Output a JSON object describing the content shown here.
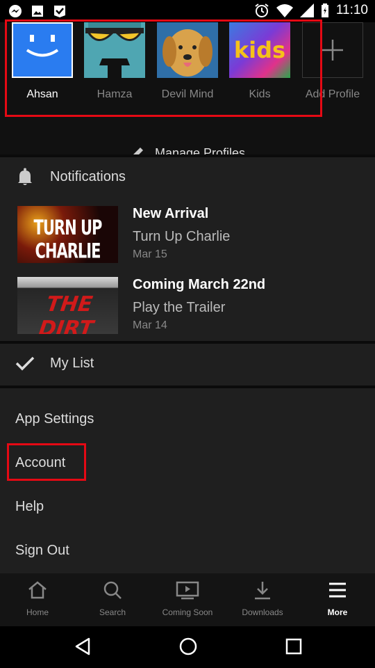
{
  "status_bar": {
    "time": "11:10"
  },
  "profiles": [
    {
      "name": "Ahsan",
      "active": true
    },
    {
      "name": "Hamza",
      "active": false
    },
    {
      "name": "Devil Mind",
      "active": false
    },
    {
      "name": "Kids",
      "active": false
    }
  ],
  "add_profile_label": "Add Profile",
  "kids_logo_text": "kids",
  "manage_profiles_label": "Manage Profiles",
  "notifications": {
    "heading": "Notifications",
    "items": [
      {
        "title": "New Arrival",
        "subtitle": "Turn Up Charlie",
        "date": "Mar 15",
        "thumb_text": "TURN UP CHARLIE"
      },
      {
        "title": "Coming March 22nd",
        "subtitle": "Play the Trailer",
        "date": "Mar 14",
        "thumb_text": "THE DIRT"
      }
    ]
  },
  "my_list_label": "My List",
  "menu": [
    "App Settings",
    "Account",
    "Help",
    "Sign Out"
  ],
  "tabs": [
    {
      "label": "Home",
      "icon": "home-icon"
    },
    {
      "label": "Search",
      "icon": "search-icon"
    },
    {
      "label": "Coming Soon",
      "icon": "play-box-icon"
    },
    {
      "label": "Downloads",
      "icon": "download-icon"
    },
    {
      "label": "More",
      "icon": "menu-icon",
      "active": true
    }
  ],
  "colors": {
    "accent_red": "#e50914",
    "background": "#1f1f1f"
  }
}
